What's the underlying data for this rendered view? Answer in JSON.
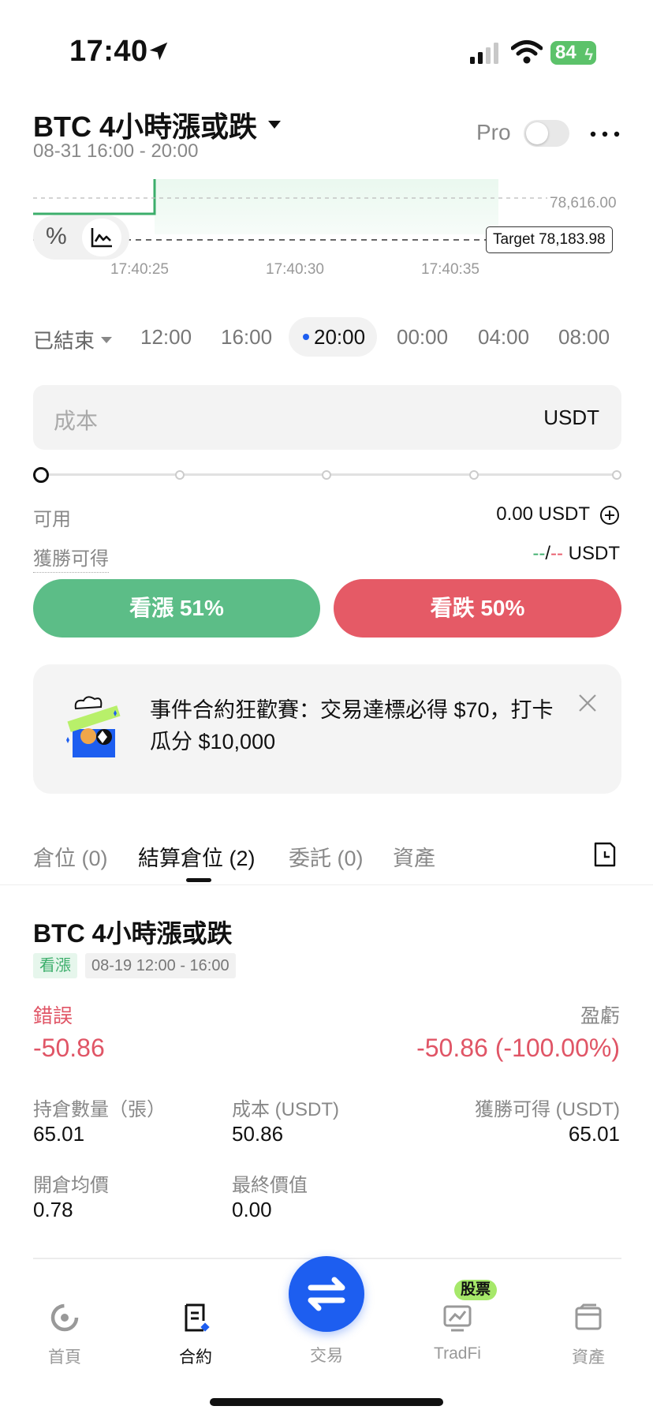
{
  "status_bar": {
    "time": "17:40",
    "battery": "84"
  },
  "header": {
    "title": "BTC 4小時漲或跌",
    "subtitle": "08-31 16:00 - 20:00",
    "pro_label": "Pro",
    "pro_enabled": false
  },
  "chart": {
    "price_label": "78,616.00",
    "target_label": "Target 78,183.98",
    "ticks": [
      "17:40:25",
      "17:40:30",
      "17:40:35"
    ]
  },
  "time_selector": {
    "ended_label": "已結束",
    "slots": [
      "12:00",
      "16:00",
      "20:00",
      "00:00",
      "04:00",
      "08:00"
    ],
    "active": "20:00"
  },
  "order": {
    "cost_placeholder": "成本",
    "cost_unit": "USDT",
    "slider_percent": 0,
    "available_label": "可用",
    "available_value": "0.00 USDT",
    "win_label": "獲勝可得",
    "win_dash_up": "--",
    "win_sep": "/",
    "win_dash_down": "--",
    "win_unit": "USDT",
    "up_button": "看漲 51%",
    "down_button": "看跌 50%"
  },
  "promo": {
    "text": "事件合約狂歡賽：交易達標必得 $70，打卡瓜分 $10,000"
  },
  "tabs": [
    {
      "label": "倉位 (0)"
    },
    {
      "label": "結算倉位 (2)"
    },
    {
      "label": "委託 (0)"
    },
    {
      "label": "資產"
    }
  ],
  "position": {
    "title": "BTC 4小時漲或跌",
    "direction_badge": "看漲",
    "time_badge": "08-19 12:00 - 16:00",
    "status_label": "錯誤",
    "status_value": "-50.86",
    "pnl_label": "盈虧",
    "pnl_value": "-50.86 (-100.00%)",
    "qty_label": "持倉數量（張）",
    "qty_value": "65.01",
    "cost_label": "成本 (USDT)",
    "cost_value": "50.86",
    "win_label": "獲勝可得 (USDT)",
    "win_value": "65.01",
    "open_avg_label": "開倉均價",
    "open_avg_value": "0.78",
    "final_value_label": "最終價值",
    "final_value_value": "0.00"
  },
  "bottom_nav": {
    "home": "首頁",
    "contract": "合約",
    "trade": "交易",
    "tradfi": "TradFi",
    "tradfi_badge": "股票",
    "assets": "資產"
  },
  "colors": {
    "up": "#5cbd87",
    "down": "#e55a66",
    "accent": "#1d5ef0"
  }
}
